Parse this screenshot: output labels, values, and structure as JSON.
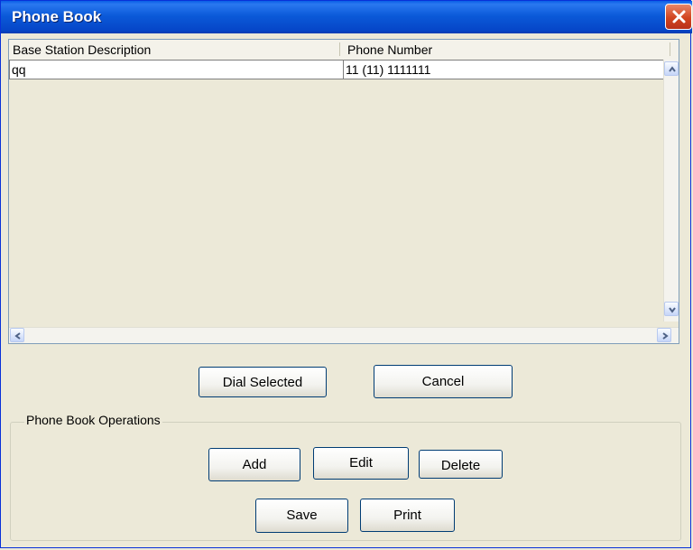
{
  "window": {
    "title": "Phone Book"
  },
  "table": {
    "columns": [
      "Base Station Description",
      "Phone Number"
    ],
    "rows": [
      {
        "description": "qq",
        "phone": "11 (11) 1111111"
      }
    ]
  },
  "buttons": {
    "dial": "Dial Selected",
    "cancel": "Cancel",
    "add": "Add",
    "edit": "Edit",
    "delete": "Delete",
    "save": "Save",
    "print": "Print"
  },
  "operations": {
    "legend": "Phone Book Operations"
  },
  "icons": {
    "close": "close-icon",
    "scroll_up": "chevron-up-icon",
    "scroll_down": "chevron-down-icon",
    "scroll_left": "chevron-left-icon",
    "scroll_right": "chevron-right-icon"
  },
  "colors": {
    "titlebar": "#0a5ee6",
    "close": "#d2451f",
    "window_bg": "#ece9d8"
  }
}
